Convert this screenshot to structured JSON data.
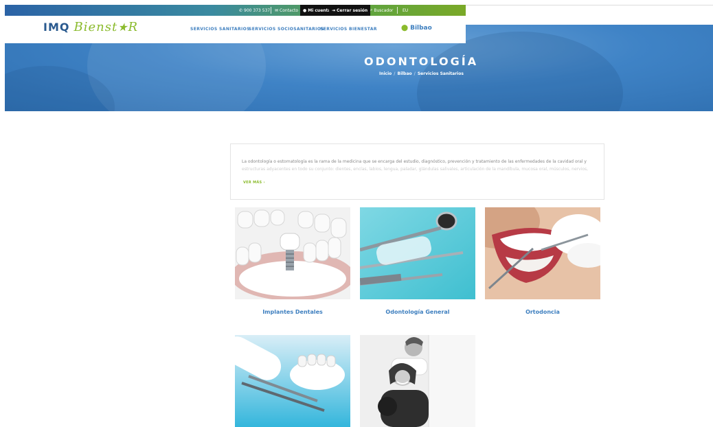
{
  "topbar": {
    "phone": "900 373 537",
    "contact": "Contacto",
    "account": "Mi cuenta",
    "logout": "Cerrar sesión",
    "search": "Buscador",
    "lang": "EU"
  },
  "logo": {
    "part1": "IMQ",
    "part2": "Bienst",
    "star": "★",
    "part3": "R"
  },
  "nav": {
    "items": [
      "SERVICIOS SANITARIOS",
      "SERVICIOS SOCIOSANITARIOS",
      "SERVICIOS BIENESTAR"
    ],
    "city": "Bilbao"
  },
  "hero": {
    "title": "ODONTOLOGÍA",
    "breadcrumb": [
      "Inicio",
      "Bilbao",
      "Servicios Sanitarios"
    ]
  },
  "intro": {
    "line1": "La odontología o estomatología es la rama de la medicina que se encarga del estudio, diagnóstico, prevención y tratamiento de las enfermedades de la cavidad oral y",
    "line2": "estructuras adyacentes en todo su conjunto: dientes, encías, labios, lengua, paladar, glándulas salivales, articulación de la mandíbula, mucosa oral, músculos, nervios,",
    "more": "VER MÁS ›"
  },
  "services": [
    {
      "label": "Implantes Dentales"
    },
    {
      "label": "Odontología General"
    },
    {
      "label": "Ortodoncia"
    },
    {
      "label": ""
    },
    {
      "label": ""
    }
  ],
  "colors": {
    "brand_blue": "#3e7fbf",
    "brand_green": "#8bbb2d",
    "hero_blue": "#3f83c6"
  }
}
